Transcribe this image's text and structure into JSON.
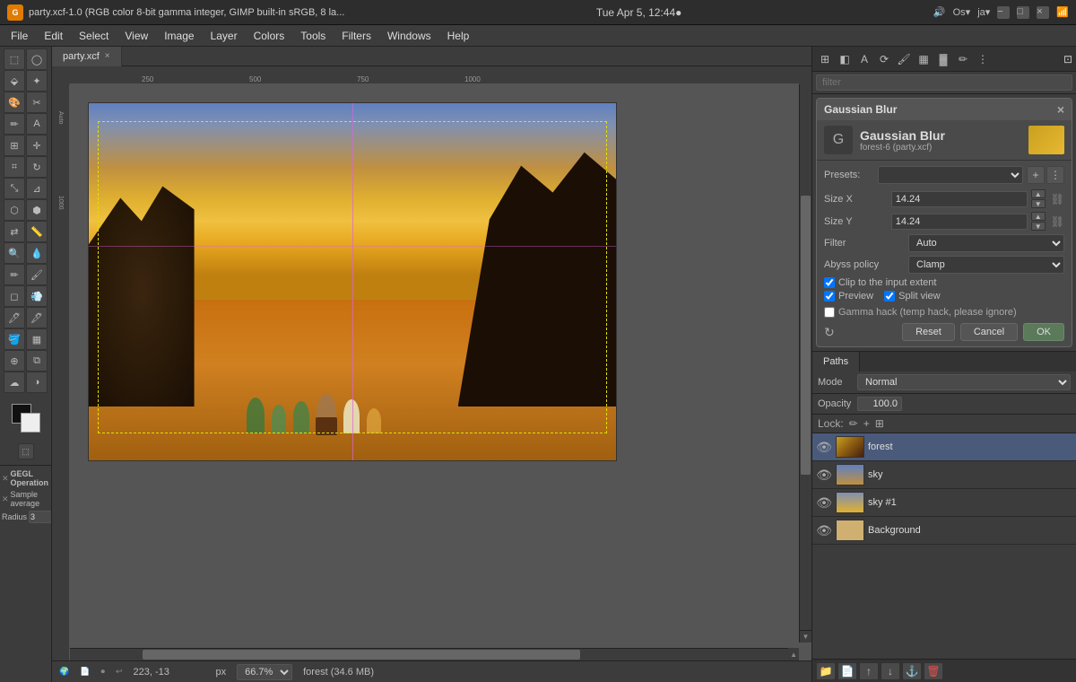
{
  "systemBar": {
    "appIcon": "G",
    "fileTitle": "party.xcf-1.0 (RGB color 8-bit gamma integer, GIMP built-in sRGB, 8 la...",
    "datetime": "Tue Apr 5, 12:44●",
    "osLabel": "Os▾",
    "userLabel": "ja▾",
    "winButtons": [
      "−",
      "□",
      "×"
    ]
  },
  "menuBar": {
    "items": [
      "File",
      "Edit",
      "Select",
      "View",
      "Image",
      "Layer",
      "Colors",
      "Tools",
      "Filters",
      "Windows",
      "Help"
    ]
  },
  "canvas": {
    "tabLabel": "party.xcf",
    "tabClose": "×",
    "statusCoords": "223, -13",
    "statusUnit": "px",
    "zoomLevel": "66.7%",
    "layerInfo": "forest (34.6 MB)"
  },
  "gaussianBlur": {
    "dialogTitle": "Gaussian Blur",
    "closeBtn": "×",
    "iconLetter": "G",
    "title": "Gaussian Blur",
    "subtitle": "forest-6 (party.xcf)",
    "presetsLabel": "Presets:",
    "presetsValue": "",
    "addBtn": "+",
    "menuBtn": "⋮",
    "sizeXLabel": "Size X",
    "sizeXValue": "14.24",
    "sizeYLabel": "Size Y",
    "sizeYValue": "14.24",
    "filterLabel": "Filter",
    "filterValue": "Auto",
    "abyssPolicyLabel": "Abyss policy",
    "abyssPolicyValue": "Clamp",
    "clipLabel": "Clip to the input extent",
    "previewLabel": "Preview",
    "splitViewLabel": "Split view",
    "gammaLabel": "Gamma hack (temp hack, please ignore)",
    "resetBtn": "Reset",
    "cancelBtn": "Cancel",
    "okBtn": "OK"
  },
  "layers": {
    "tabs": [
      "Paths"
    ],
    "modeLabel": "Mode",
    "modeValue": "Normal",
    "opacityLabel": "Opacity",
    "opacityValue": "100.0",
    "lockLabel": "Lock:",
    "lockIcons": [
      "✏",
      "+",
      "⊞"
    ],
    "items": [
      {
        "name": "forest",
        "visible": true,
        "thumbClass": "layer-thumb-forest",
        "active": true
      },
      {
        "name": "sky",
        "visible": true,
        "thumbClass": "layer-thumb-sky",
        "active": false
      },
      {
        "name": "sky #1",
        "visible": true,
        "thumbClass": "layer-thumb-sky1",
        "active": false
      },
      {
        "name": "Background",
        "visible": true,
        "thumbClass": "layer-thumb-bg",
        "active": false
      }
    ],
    "toolbarBtns": [
      "📁",
      "📄",
      "↑",
      "↓",
      "⚓",
      "🗑"
    ]
  },
  "toolbox": {
    "tools": [
      [
        "⬚",
        "⬚"
      ],
      [
        "◯",
        "⬙"
      ],
      [
        "🔍",
        "✏"
      ],
      [
        "⬚",
        "⬚"
      ],
      [
        "⬚",
        "⬚"
      ],
      [
        "⬚",
        "⬚"
      ],
      [
        "⬚",
        "⬚"
      ],
      [
        "⬚",
        "⬚"
      ],
      [
        "⬚",
        "⬚"
      ],
      [
        "⬚",
        "⬚"
      ],
      [
        "⬚",
        "⬚"
      ],
      [
        "⬚",
        "⬚"
      ],
      [
        "⬚",
        "⬚"
      ],
      [
        "⬚",
        "⬚"
      ],
      [
        "⬚",
        "⬚"
      ],
      [
        "⬚",
        "⬚"
      ]
    ]
  },
  "gegl": {
    "title": "GEGL Operation",
    "checkLabel": "Sample average",
    "radiusLabel": "Radius",
    "radiusValue": "3"
  },
  "filterSearch": {
    "placeholder": "filter"
  },
  "ruler": {
    "ticks": [
      "250",
      "500",
      "750",
      "1000"
    ]
  }
}
